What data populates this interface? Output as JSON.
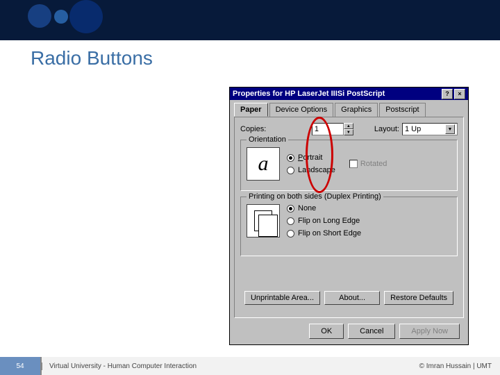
{
  "slide": {
    "title": "Radio Buttons",
    "page_number": "54",
    "footer_mid": "Virtual University - Human Computer Interaction",
    "footer_right": "© Imran Hussain | UMT"
  },
  "dialog": {
    "title": "Properties for HP LaserJet IIISi PostScript",
    "help_btn": "?",
    "close_btn": "×",
    "tabs": [
      "Paper",
      "Device Options",
      "Graphics",
      "Postscript"
    ],
    "copies_label": "Copies:",
    "copies_value": "1",
    "layout_label": "Layout:",
    "layout_value": "1 Up",
    "orientation": {
      "title": "Orientation",
      "options": [
        "Portrait",
        "Landscape"
      ],
      "selected": "Portrait",
      "rotated_label": "Rotated"
    },
    "duplex": {
      "title": "Printing on both sides (Duplex Printing)",
      "options": [
        "None",
        "Flip on Long Edge",
        "Flip on Short Edge"
      ],
      "selected": "None"
    },
    "mid_buttons": [
      "Unprintable Area...",
      "About...",
      "Restore Defaults"
    ],
    "buttons": {
      "ok": "OK",
      "cancel": "Cancel",
      "apply": "Apply Now"
    }
  }
}
